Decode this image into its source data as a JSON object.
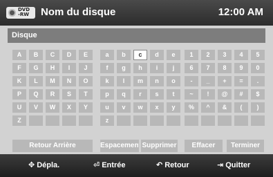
{
  "header": {
    "badge_line1": "DVD",
    "badge_line2": "-RW",
    "title": "Nom du disque",
    "clock": "12:00 AM"
  },
  "input": {
    "value": "Disque"
  },
  "keyboard": {
    "uppercase": [
      [
        "A",
        "B",
        "C",
        "D",
        "E"
      ],
      [
        "F",
        "G",
        "H",
        "I",
        "J"
      ],
      [
        "K",
        "L",
        "M",
        "N",
        "O"
      ],
      [
        "P",
        "Q",
        "R",
        "S",
        "T"
      ],
      [
        "U",
        "V",
        "W",
        "X",
        "Y"
      ],
      [
        "Z",
        "",
        "",
        "",
        ""
      ]
    ],
    "lowercase": [
      [
        "a",
        "b",
        "c",
        "d",
        "e"
      ],
      [
        "f",
        "g",
        "h",
        "i",
        "j"
      ],
      [
        "k",
        "l",
        "m",
        "n",
        "o"
      ],
      [
        "p",
        "q",
        "r",
        "s",
        "t"
      ],
      [
        "u",
        "v",
        "w",
        "x",
        "y"
      ],
      [
        "z",
        "",
        "",
        "",
        ""
      ]
    ],
    "symbols": [
      [
        "1",
        "2",
        "3",
        "4",
        "5"
      ],
      [
        "6",
        "7",
        "8",
        "9",
        "0"
      ],
      [
        "-",
        "_",
        "+",
        "=",
        "."
      ],
      [
        "~",
        "!",
        "@",
        "#",
        "$"
      ],
      [
        "%",
        "^",
        "&",
        "(",
        ")"
      ],
      [
        "",
        "",
        "",
        "",
        ""
      ]
    ],
    "selected_key": "c"
  },
  "functions": {
    "back": "Retour Arrière",
    "space": "Espacement",
    "delete": "Supprimer",
    "clear": "Effacer",
    "finish": "Terminer"
  },
  "footer": {
    "move": "Dépla.",
    "enter": "Entrée",
    "return": "Retour",
    "quit": "Quitter"
  },
  "colors": {
    "header_bg": "#333333",
    "panel_bg": "#d2d2d2",
    "key_bg": "#b8b8b8",
    "input_bg": "#7d7d7d",
    "selected_bg": "#ffffff"
  }
}
